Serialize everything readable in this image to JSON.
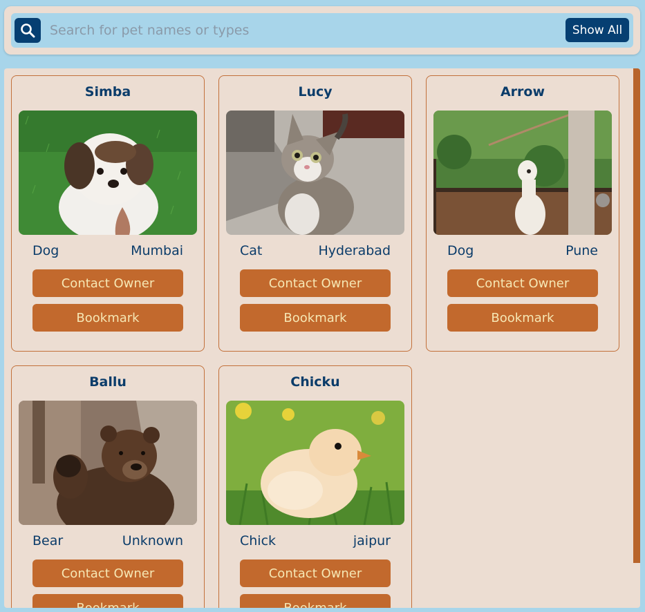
{
  "search": {
    "placeholder": "Search for pet names or types",
    "value": "",
    "show_all_label": "Show All",
    "icon": "search-icon"
  },
  "colors": {
    "page_bg": "#a8d5ea",
    "panel_bg": "#ecddd2",
    "dark_blue": "#063f72",
    "accent": "#c2692d",
    "button_text": "#f6e7b4"
  },
  "pets": [
    {
      "name": "Simba",
      "type": "Dog",
      "city": "Mumbai",
      "contact_label": "Contact Owner",
      "bookmark_label": "Bookmark"
    },
    {
      "name": "Lucy",
      "type": "Cat",
      "city": "Hyderabad",
      "contact_label": "Contact Owner",
      "bookmark_label": "Bookmark"
    },
    {
      "name": "Arrow",
      "type": "Dog",
      "city": "Pune",
      "contact_label": "Contact Owner",
      "bookmark_label": "Bookmark"
    },
    {
      "name": "Ballu",
      "type": "Bear",
      "city": "Unknown",
      "contact_label": "Contact Owner",
      "bookmark_label": "Bookmark"
    },
    {
      "name": "Chicku",
      "type": "Chick",
      "city": "jaipur",
      "contact_label": "Contact Owner",
      "bookmark_label": "Bookmark"
    }
  ]
}
